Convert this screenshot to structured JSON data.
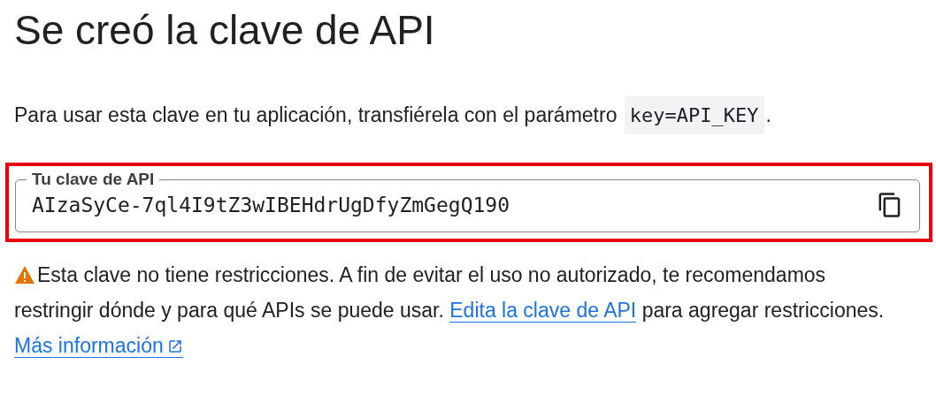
{
  "title": "Se creó la clave de API",
  "intro": {
    "text": "Para usar esta clave en tu aplicación, transfiérela con el parámetro",
    "code": "key=API_KEY",
    "end": "."
  },
  "key_field": {
    "label": "Tu clave de API",
    "value": "AIzaSyCe-7ql4I9tZ3wIBEHdrUgDfyZmGegQ190"
  },
  "warning": {
    "text": "Esta clave no tiene restricciones. A fin de evitar el uso no autorizado, te recomendamos restringir dónde y para qué APIs se puede usar.",
    "edit_link": "Edita la clave de API",
    "tail": "para agregar restricciones.",
    "more_link": "Más información"
  }
}
